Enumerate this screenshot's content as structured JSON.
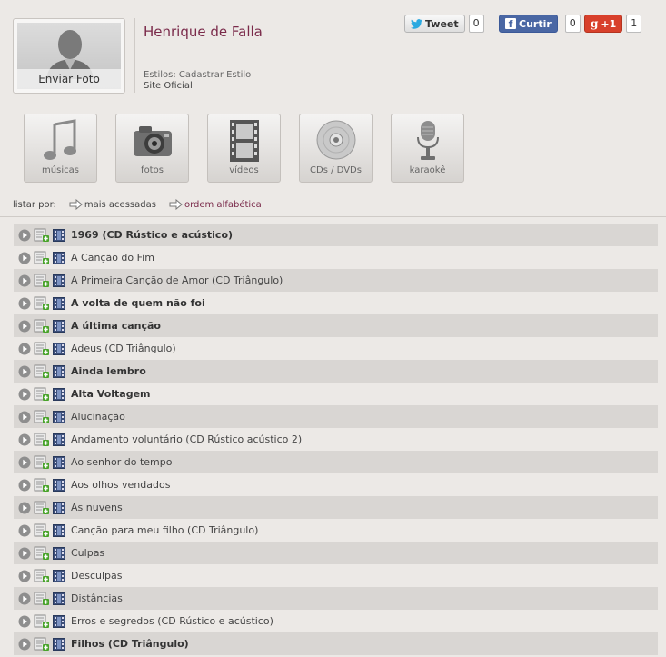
{
  "header": {
    "photo_caption": "Enviar Foto",
    "artist_name": "Henrique de Falla",
    "styles_label": "Estilos:",
    "styles_value": "Cadastrar Estilo",
    "site_link": "Site Oficial"
  },
  "social": {
    "tweet_label": "Tweet",
    "tweet_count": "0",
    "curtir_label": "Curtir",
    "curtir_count": "0",
    "gplus_label": "+1",
    "gplus_count": "1"
  },
  "tiles": [
    {
      "label": "músicas",
      "icon": "music-note-icon"
    },
    {
      "label": "fotos",
      "icon": "camera-icon"
    },
    {
      "label": "vídeos",
      "icon": "film-strip-icon"
    },
    {
      "label": "CDs / DVDs",
      "icon": "disc-icon"
    },
    {
      "label": "karaokê",
      "icon": "microphone-icon"
    }
  ],
  "list_by": {
    "label": "listar por:",
    "most_accessed": "mais acessadas",
    "alphabetical": "ordem alfabética"
  },
  "songs": [
    {
      "title": "1969 (CD Rústico e acústico)",
      "bold": true
    },
    {
      "title": "A Canção do Fim",
      "bold": false
    },
    {
      "title": "A Primeira Canção de Amor (CD Triângulo)",
      "bold": false
    },
    {
      "title": "A volta de quem não foi",
      "bold": true
    },
    {
      "title": "A última canção",
      "bold": true
    },
    {
      "title": "Adeus (CD Triângulo)",
      "bold": false
    },
    {
      "title": "Ainda lembro",
      "bold": true
    },
    {
      "title": "Alta Voltagem",
      "bold": true
    },
    {
      "title": "Alucinação",
      "bold": false
    },
    {
      "title": "Andamento voluntário (CD Rústico acústico 2)",
      "bold": false
    },
    {
      "title": "Ao senhor do tempo",
      "bold": false
    },
    {
      "title": "Aos olhos vendados",
      "bold": false
    },
    {
      "title": "As nuvens",
      "bold": false
    },
    {
      "title": "Canção para meu filho (CD Triângulo)",
      "bold": false
    },
    {
      "title": "Culpas",
      "bold": false
    },
    {
      "title": "Desculpas",
      "bold": false
    },
    {
      "title": "Distâncias",
      "bold": false
    },
    {
      "title": "Erros e segredos (CD Rústico e acústico)",
      "bold": false
    },
    {
      "title": "Filhos (CD Triângulo)",
      "bold": true
    }
  ]
}
